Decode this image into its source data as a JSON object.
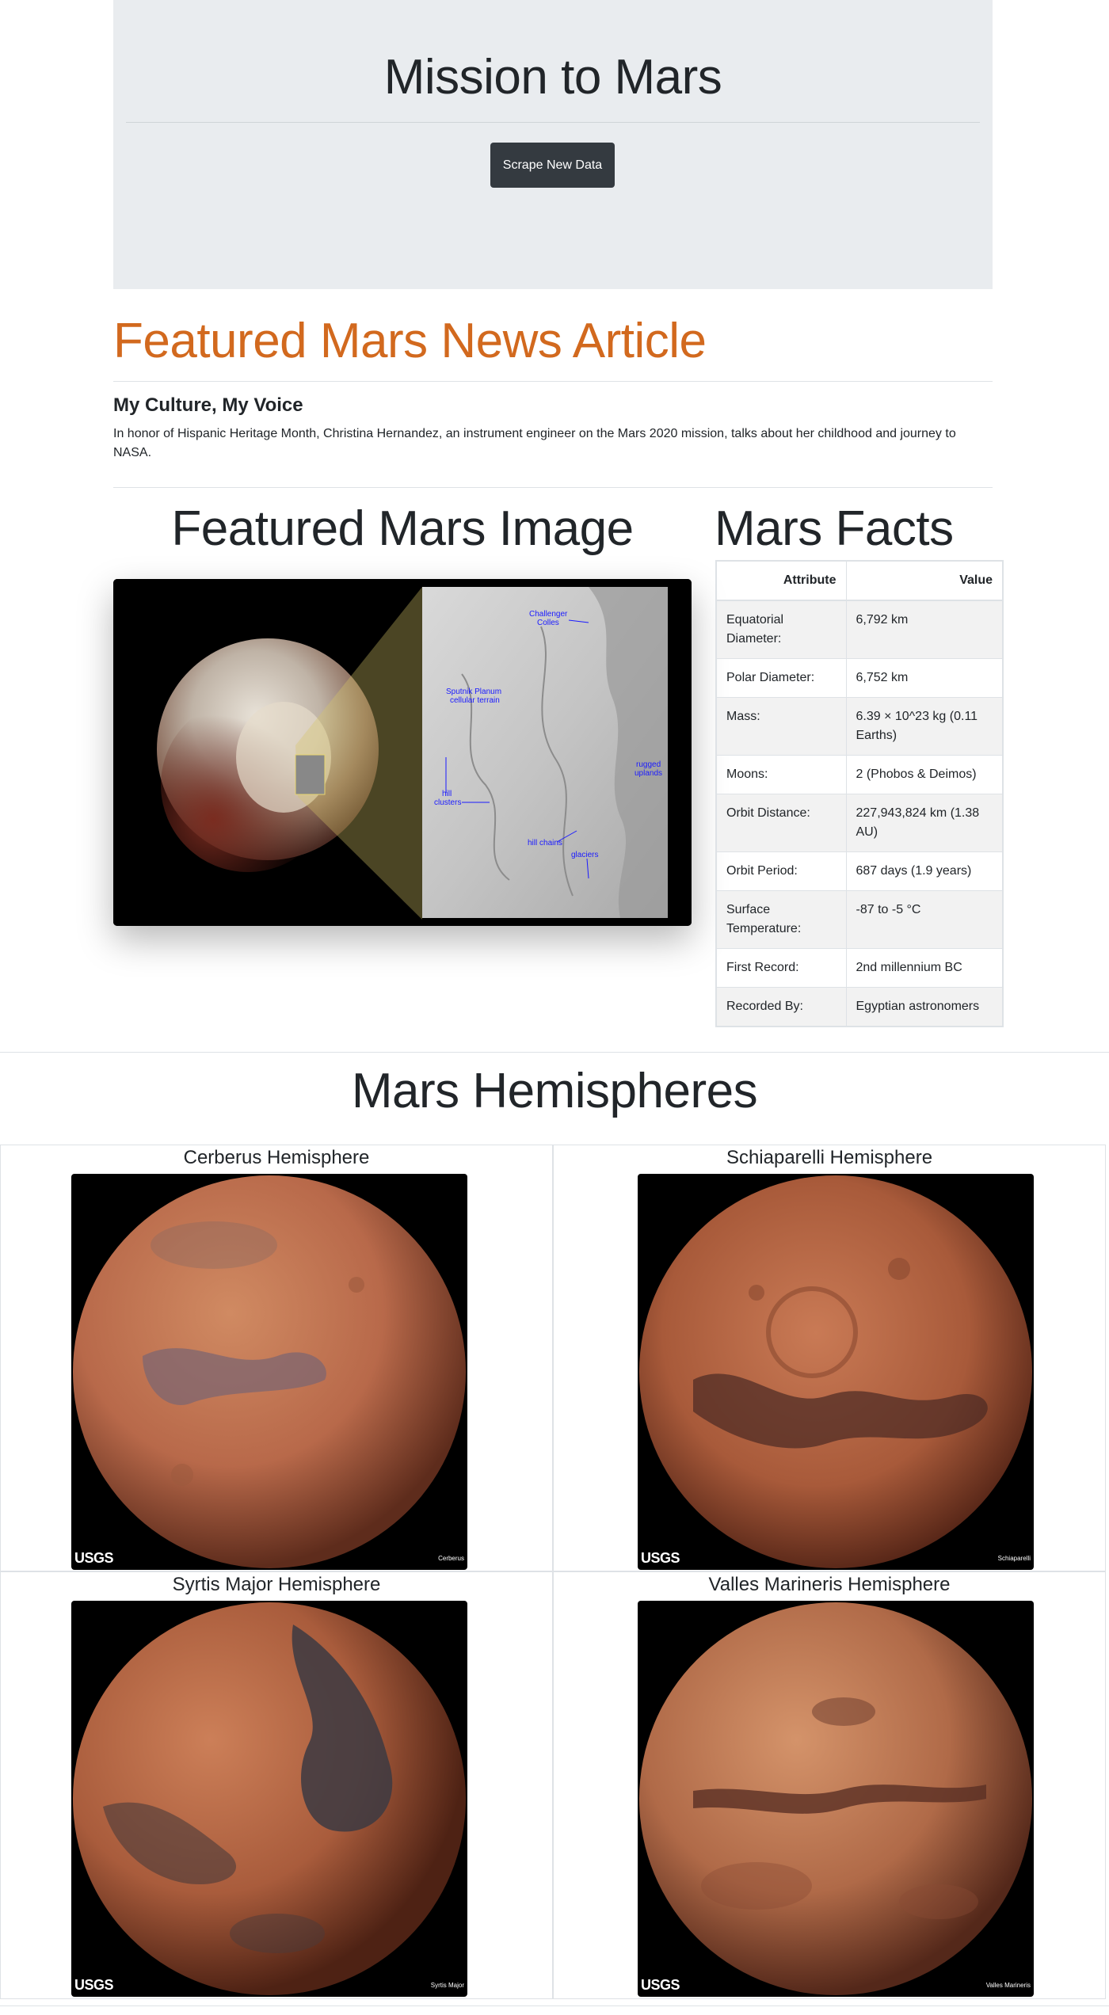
{
  "header": {
    "title": "Mission to Mars",
    "scrape_button": "Scrape New Data"
  },
  "news": {
    "heading": "Featured Mars News Article",
    "title": "My Culture, My Voice",
    "paragraph": "In honor of Hispanic Heritage Month, Christina Hernandez, an instrument engineer on the Mars 2020 mission, talks about her childhood and journey to NASA."
  },
  "featured_image": {
    "heading": "Featured Mars Image",
    "labels": [
      "Challenger Colles",
      "Sputnik Planum cellular terrain",
      "rugged uplands",
      "hill clusters",
      "hill chains",
      "glaciers"
    ]
  },
  "facts": {
    "heading": "Mars Facts",
    "columns": [
      "Attribute",
      "Value"
    ],
    "rows": [
      [
        "Equatorial Diameter:",
        "6,792 km"
      ],
      [
        "Polar Diameter:",
        "6,752 km"
      ],
      [
        "Mass:",
        "6.39 × 10^23 kg (0.11 Earths)"
      ],
      [
        "Moons:",
        "2 (Phobos & Deimos)"
      ],
      [
        "Orbit Distance:",
        "227,943,824 km (1.38 AU)"
      ],
      [
        "Orbit Period:",
        "687 days (1.9 years)"
      ],
      [
        "Surface Temperature:",
        "-87 to -5 °C"
      ],
      [
        "First Record:",
        "2nd millennium BC"
      ],
      [
        "Recorded By:",
        "Egyptian astronomers"
      ]
    ]
  },
  "hemispheres": {
    "heading": "Mars Hemispheres",
    "logo_text": "USGS",
    "items": [
      {
        "title": "Cerberus Hemisphere",
        "tag": "Cerberus"
      },
      {
        "title": "Schiaparelli Hemisphere",
        "tag": "Schiaparelli"
      },
      {
        "title": "Syrtis Major Hemisphere",
        "tag": "Syrtis Major"
      },
      {
        "title": "Valles Marineris Hemisphere",
        "tag": "Valles Marineris"
      }
    ]
  },
  "colors": {
    "jumbotron_bg": "#e9ecef",
    "button_bg": "#343a40",
    "news_heading": "#d2691e",
    "table_stripe": "#f2f2f2"
  }
}
